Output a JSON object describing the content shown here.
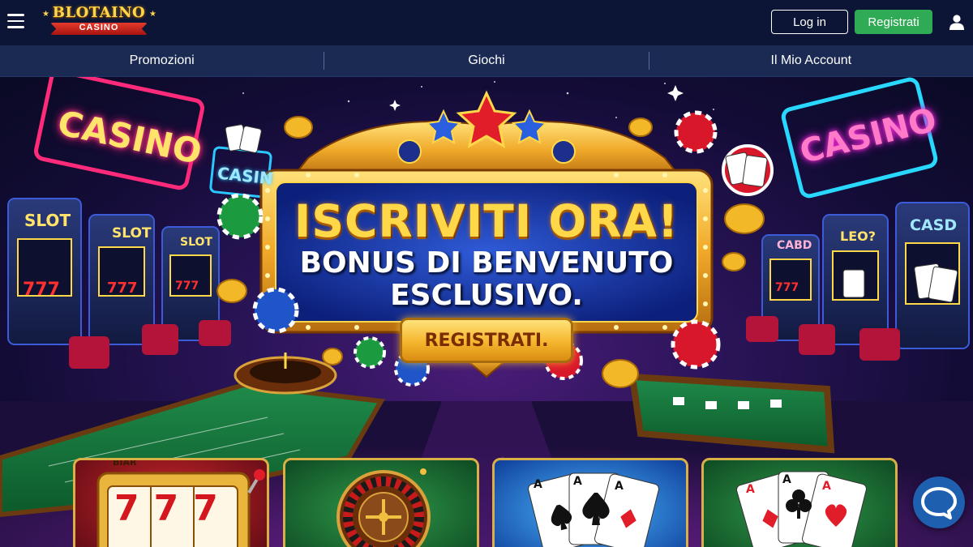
{
  "header": {
    "logo_text": "BLOTAINO",
    "logo_sub": "CASINO",
    "login_label": "Log in",
    "register_label": "Registrati",
    "menu_icon": "hamburger-icon",
    "user_icon": "user-icon"
  },
  "nav": {
    "items": [
      {
        "label": "Promozioni"
      },
      {
        "label": "Giochi"
      },
      {
        "label": "Il Mio Account"
      }
    ]
  },
  "hero": {
    "title": "ISCRIVITI ORA!",
    "subtitle_line1": "BONUS DI BENVENUTO",
    "subtitle_line2": "ESCLUSIVO.",
    "cta_label": "REGISTRATI.",
    "neon_left": "CASINO",
    "neon_right": "CASINO",
    "neon_small": "CASIN",
    "slot_labels": [
      "SLOT",
      "SLOT",
      "SLOT",
      "CABD",
      "LEO?",
      "CASD"
    ],
    "slot_reels": "777"
  },
  "game_tiles": [
    {
      "name": "slot-tile",
      "icon": "slot-machine-icon",
      "reels": "777",
      "top_label": "BIAR"
    },
    {
      "name": "roulette-tile",
      "icon": "roulette-wheel-icon"
    },
    {
      "name": "poker-tile",
      "icon": "spade-cards-icon",
      "ranks": [
        "A",
        "A",
        "A"
      ]
    },
    {
      "name": "blackjack-tile",
      "icon": "heart-cards-icon",
      "ranks": [
        "A",
        "A",
        "A"
      ]
    }
  ],
  "chat": {
    "icon": "chat-bubble-icon"
  },
  "colors": {
    "header_bg": "#0c1535",
    "nav_bg": "#1a2a52",
    "register_green": "#2faa55",
    "gold": "#ffd84a",
    "chat_blue": "#1f5fb0"
  }
}
